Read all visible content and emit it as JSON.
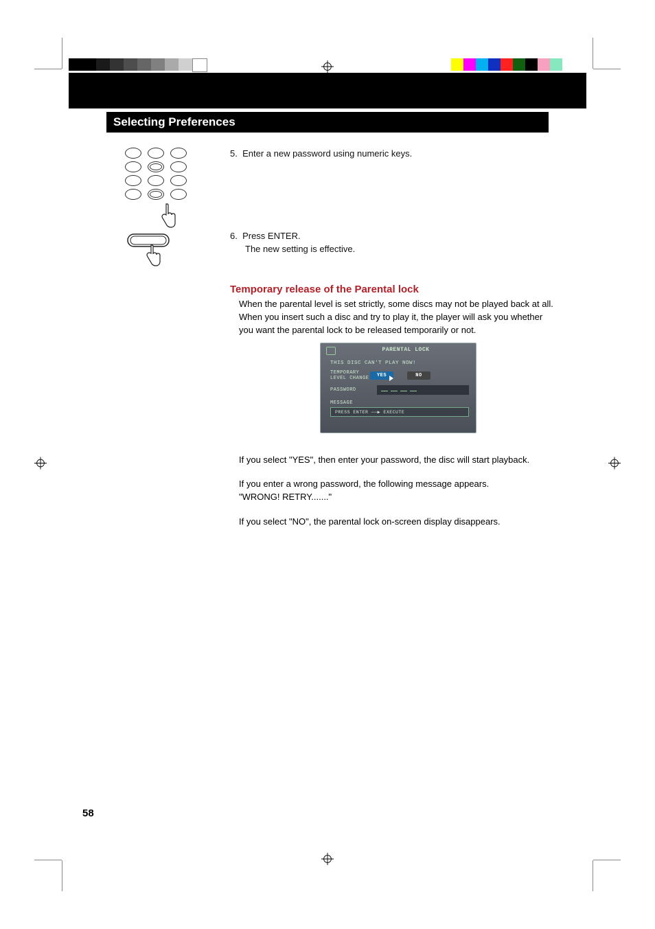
{
  "title": "Selecting Preferences",
  "steps": {
    "s5": {
      "num": "5.",
      "text": "Enter a new password using numeric keys."
    },
    "s6": {
      "num": "6.",
      "line1": "Press ENTER.",
      "line2": "The new setting is effective."
    }
  },
  "subheading": "Temporary release of the Parental lock",
  "sub_desc": "When the parental level is set strictly, some discs may not be played back at all. When you insert such a disc and try to play it, the player will ask you whether you want the parental lock to be released temporarily or not.",
  "osd": {
    "header": "PARENTAL LOCK",
    "line1": "THIS DISC CAN'T PLAY NOW!",
    "label_change_l1": "TEMPORARY",
    "label_change_l2": "LEVEL CHANGE",
    "yes": "YES",
    "no": "NO",
    "password": "PASSWORD",
    "message_label": "MESSAGE",
    "message_text": "PRESS  ENTER ──▶ EXECUTE"
  },
  "paragraphs": {
    "p1": "If you select \"YES\", then enter your password, the disc will start playback.",
    "p2a": "If you enter a wrong password, the following message appears.",
    "p2b": "\"WRONG! RETRY.......\"",
    "p3": "If you select \"NO\", the parental lock on-screen display disappears."
  },
  "page_number": "58",
  "gray_shades": [
    "#000000",
    "#000000",
    "#1a1a1a",
    "#333333",
    "#4d4d4d",
    "#666666",
    "#808080",
    "#aaaaaa",
    "#d0d0d0",
    "#ffffff"
  ],
  "color_swatches": [
    "#ffff00",
    "#ff00ff",
    "#00b0f0",
    "#1030c0",
    "#ff2020",
    "#106010",
    "#000000",
    "#f7a0c0",
    "#87e8c0"
  ]
}
